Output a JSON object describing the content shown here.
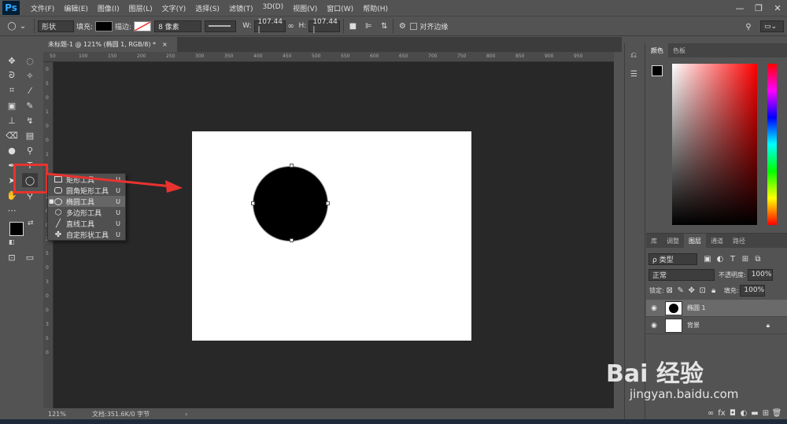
{
  "app": {
    "logo": "Ps",
    "menus": [
      "文件(F)",
      "编辑(E)",
      "图像(I)",
      "图层(L)",
      "文字(Y)",
      "选择(S)",
      "滤镜(T)",
      "3D(D)",
      "视图(V)",
      "窗口(W)",
      "帮助(H)"
    ],
    "window_controls": [
      "—",
      "❐",
      "✕"
    ]
  },
  "options": {
    "mode": "形状",
    "fill_label": "填充:",
    "stroke_label": "描边:",
    "stroke_width": "8 像素",
    "w_label": "W:",
    "w_value": "107.44 |",
    "h_label": "H:",
    "h_value": "107.44 |",
    "align_edges": "对齐边缘"
  },
  "document": {
    "tab_title": "未标题-1 @ 121% (椭圆 1, RGB/8) *",
    "zoom": "121%",
    "doc_info": "文档:351.6K/0 字节"
  },
  "rulers": {
    "top": [
      "50",
      "100",
      "150",
      "200",
      "250",
      "300",
      "350",
      "400",
      "450",
      "500",
      "550",
      "600",
      "650",
      "700",
      "750",
      "800",
      "850",
      "900",
      "950"
    ],
    "left": [
      "0",
      "5",
      "0",
      "1",
      "0",
      "0",
      "1",
      "5",
      "0",
      "2",
      "0",
      "0",
      "2",
      "5",
      "0",
      "3",
      "0",
      "0",
      "3",
      "5",
      "0"
    ]
  },
  "flyout": {
    "items": [
      {
        "label": "矩形工具",
        "key": "U",
        "icon": "rectangle-icon",
        "selected": false
      },
      {
        "label": "圆角矩形工具",
        "key": "U",
        "icon": "rounded-rectangle-icon",
        "selected": false
      },
      {
        "label": "椭圆工具",
        "key": "U",
        "icon": "ellipse-icon",
        "selected": true
      },
      {
        "label": "多边形工具",
        "key": "U",
        "icon": "polygon-icon",
        "selected": false
      },
      {
        "label": "直线工具",
        "key": "U",
        "icon": "line-icon",
        "selected": false
      },
      {
        "label": "自定形状工具",
        "key": "U",
        "icon": "custom-shape-icon",
        "selected": false
      }
    ]
  },
  "color_panel": {
    "tabs": [
      "颜色",
      "色板"
    ]
  },
  "layers_panel": {
    "tabs": [
      "库",
      "调整",
      "图层",
      "通道",
      "路径"
    ],
    "filter_kind": "ρ 类型",
    "blend_mode": "正常",
    "opacity_label": "不透明度:",
    "opacity_value": "100%",
    "lock_label": "锁定:",
    "fill_label": "填充:",
    "fill_value": "100%",
    "layers": [
      {
        "name": "椭圆 1",
        "selected": true
      },
      {
        "name": "背景",
        "selected": false
      }
    ],
    "bottom_icons": [
      "link-icon",
      "fx-icon",
      "mask-icon",
      "adjustment-icon",
      "folder-icon",
      "new-layer-icon",
      "trash-icon"
    ]
  },
  "colors": {
    "accent": "#31a8ff",
    "annotation_red": "#e8332f",
    "foreground": "#000000",
    "background": "#ffffff"
  },
  "watermark": {
    "brand": "Bai 经验",
    "url": "jingyan.baidu.com"
  }
}
